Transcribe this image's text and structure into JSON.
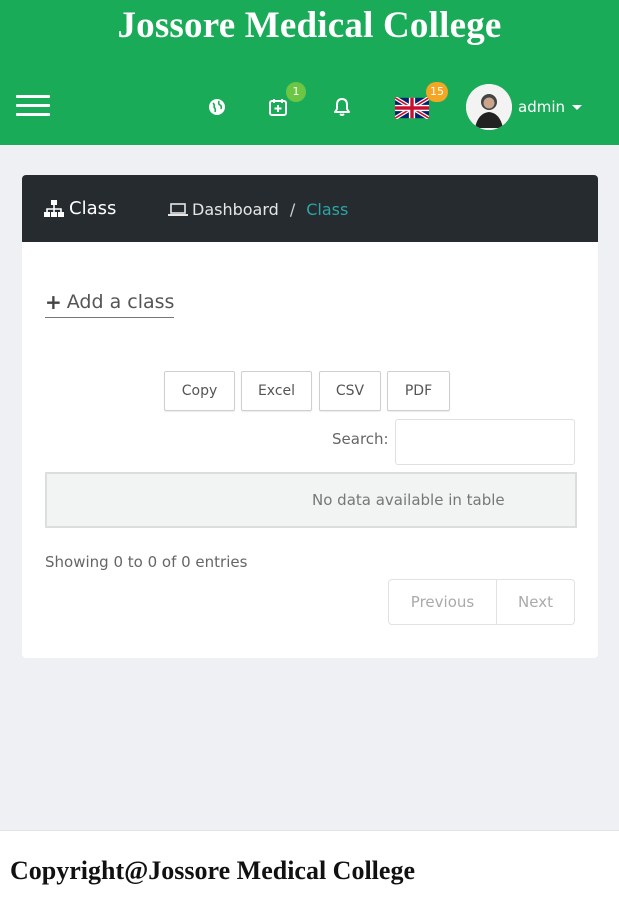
{
  "header": {
    "site_title": "Jossore Medical College",
    "calendar_badge": "1",
    "language_badge": "15",
    "user_name": "admin"
  },
  "card": {
    "title": "Class",
    "breadcrumb": {
      "dashboard": "Dashboard",
      "separator": "/",
      "current": "Class"
    },
    "add_label": "Add a class",
    "buttons": {
      "copy": "Copy",
      "excel": "Excel",
      "csv": "CSV",
      "pdf": "PDF"
    },
    "search_label": "Search:",
    "search_value": "",
    "empty_message": "No data available in table",
    "info_text": "Showing 0 to 0 of 0 entries",
    "pagination": {
      "previous": "Previous",
      "next": "Next"
    }
  },
  "footer": {
    "text": "Copyright@Jossore Medical College"
  },
  "colors": {
    "header_bg": "#1aab58",
    "card_head_bg": "#262b2f",
    "accent": "#2ca5a5",
    "badge_green": "#6cc644",
    "badge_orange": "#f5a623"
  }
}
